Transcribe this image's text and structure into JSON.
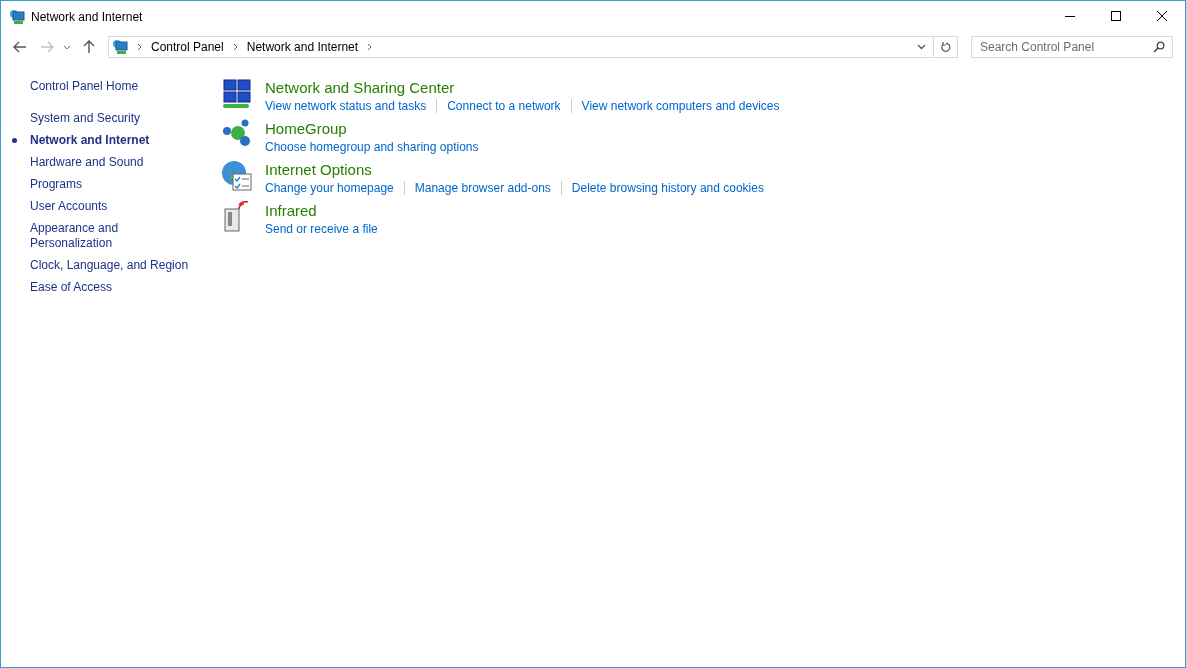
{
  "window": {
    "title": "Network and Internet"
  },
  "address_bar": {
    "breadcrumbs": [
      "Control Panel",
      "Network and Internet"
    ]
  },
  "search": {
    "placeholder": "Search Control Panel"
  },
  "sidebar": {
    "home": "Control Panel Home",
    "items": [
      {
        "label": "System and Security",
        "selected": false
      },
      {
        "label": "Network and Internet",
        "selected": true
      },
      {
        "label": "Hardware and Sound",
        "selected": false
      },
      {
        "label": "Programs",
        "selected": false
      },
      {
        "label": "User Accounts",
        "selected": false
      },
      {
        "label": "Appearance and Personalization",
        "selected": false
      },
      {
        "label": "Clock, Language, and Region",
        "selected": false
      },
      {
        "label": "Ease of Access",
        "selected": false
      }
    ]
  },
  "categories": [
    {
      "kind": "network",
      "title": "Network and Sharing Center",
      "links": [
        "View network status and tasks",
        "Connect to a network",
        "View network computers and devices"
      ]
    },
    {
      "kind": "homegroup",
      "title": "HomeGroup",
      "links": [
        "Choose homegroup and sharing options"
      ]
    },
    {
      "kind": "internet",
      "title": "Internet Options",
      "links": [
        "Change your homepage",
        "Manage browser add-ons",
        "Delete browsing history and cookies"
      ]
    },
    {
      "kind": "infrared",
      "title": "Infrared",
      "links": [
        "Send or receive a file"
      ]
    }
  ]
}
